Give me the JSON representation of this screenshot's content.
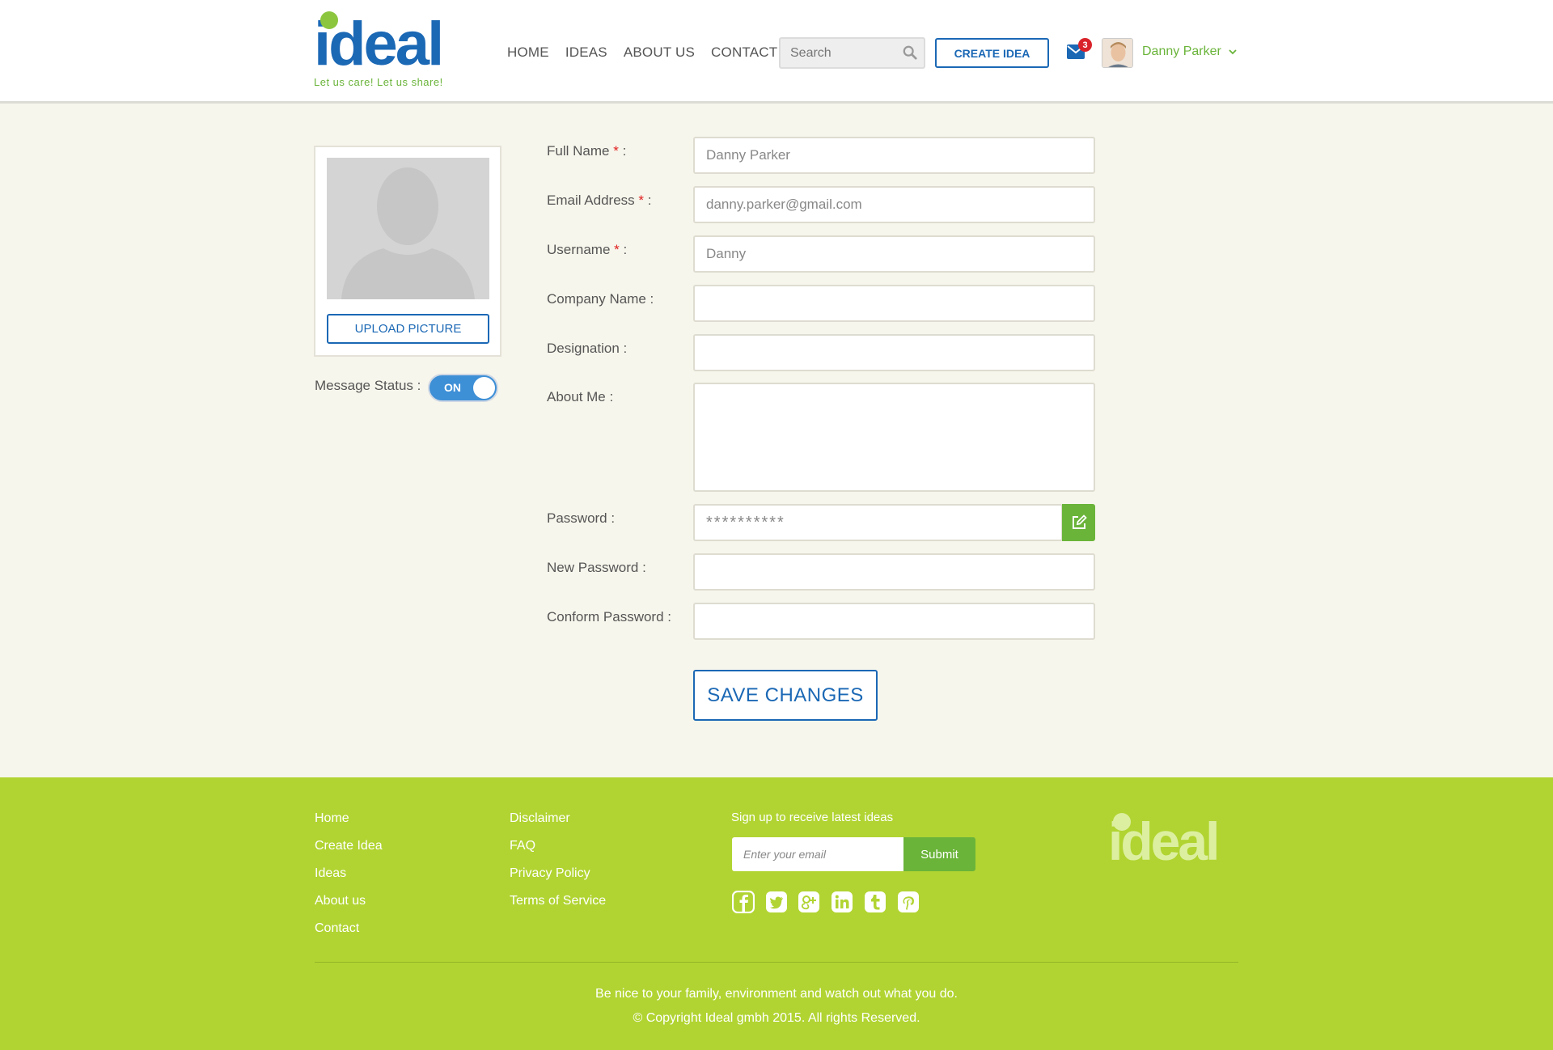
{
  "brand": {
    "logo_text": "ideal",
    "tagline": "Let us care! Let us share!",
    "primary_color": "#1b68b5",
    "accent_color": "#6ab43a",
    "footer_color": "#b1d432"
  },
  "nav": {
    "items": [
      {
        "label": "HOME"
      },
      {
        "label": "IDEAS"
      },
      {
        "label": "ABOUT US"
      },
      {
        "label": "CONTACT"
      }
    ]
  },
  "header": {
    "search_placeholder": "Search",
    "create_label": "CREATE IDEA",
    "mail_count": "3",
    "user_name": "Danny Parker"
  },
  "profile": {
    "upload_label": "UPLOAD PICTURE",
    "message_status_label": "Message Status :",
    "message_status_value": "ON"
  },
  "form": {
    "full_name": {
      "label": "Full Name",
      "required": "*",
      "suffix": ":",
      "value": "Danny Parker"
    },
    "email": {
      "label": "Email Address",
      "required": "*",
      "suffix": ":",
      "value": "danny.parker@gmail.com"
    },
    "username": {
      "label": "Username",
      "required": "*",
      "suffix": ":",
      "value": "Danny"
    },
    "company": {
      "label": "Company Name :",
      "value": ""
    },
    "designation": {
      "label": "Designation :",
      "value": ""
    },
    "about": {
      "label": "About Me :",
      "value": ""
    },
    "password": {
      "label": "Password :",
      "value": "**********"
    },
    "new_password": {
      "label": "New Password :",
      "value": ""
    },
    "confirm_password": {
      "label": "Conform Password :",
      "value": ""
    },
    "save_label": "SAVE CHANGES"
  },
  "footer": {
    "col1": [
      "Home",
      "Create Idea",
      "Ideas",
      "About us",
      "Contact"
    ],
    "col2": [
      "Disclaimer",
      "FAQ",
      "Privacy Policy",
      "Terms of Service"
    ],
    "signup_text": "Sign up to receive latest ideas",
    "email_placeholder": "Enter your email",
    "submit_label": "Submit",
    "social_icons": [
      "facebook-icon",
      "twitter-icon",
      "google-plus-icon",
      "linkedin-icon",
      "tumblr-icon",
      "pinterest-icon"
    ],
    "logo_text": "ideal",
    "tagline": "Be nice to your family, environment and watch out what you do.",
    "copyright": "© Copyright Ideal gmbh 2015. All rights Reserved."
  }
}
